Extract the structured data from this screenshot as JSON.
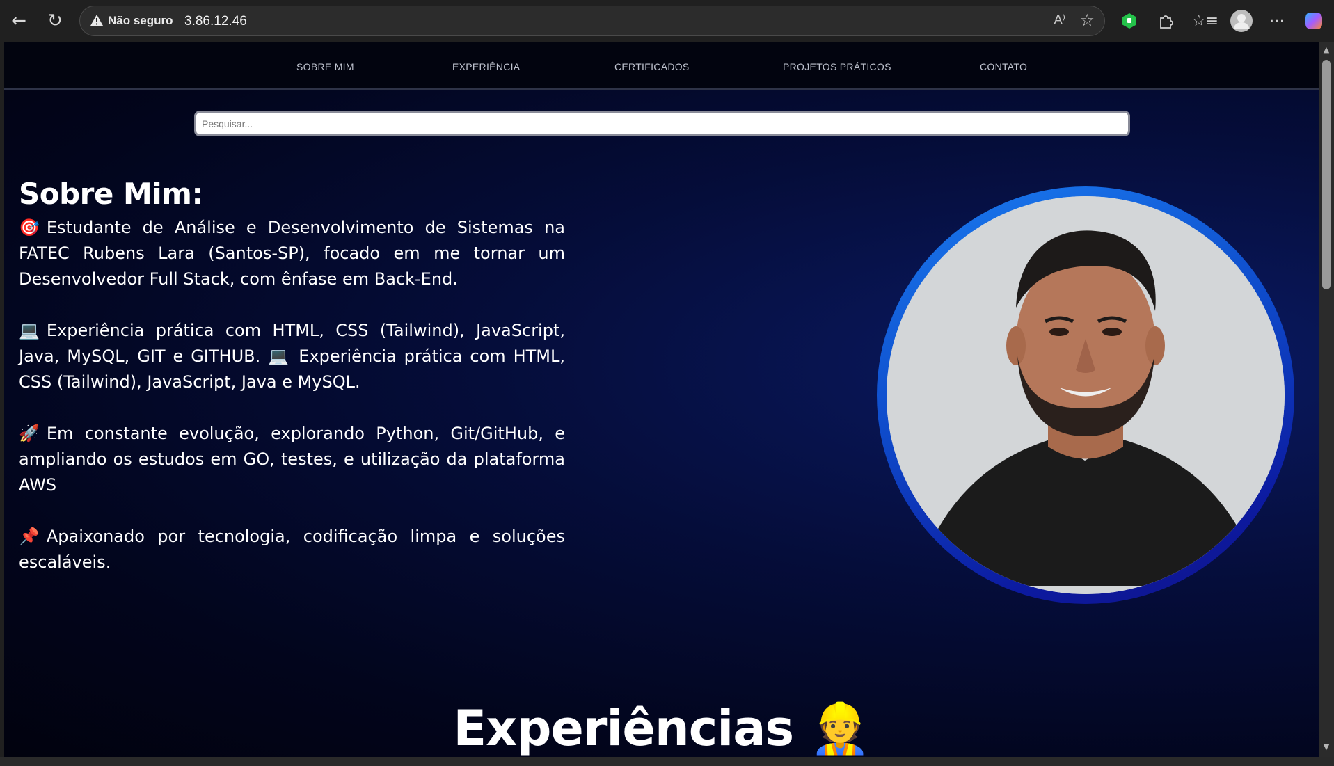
{
  "browser": {
    "security_label": "Não seguro",
    "url": "3.86.12.46",
    "read_aloud_label": "A⁾"
  },
  "site": {
    "nav": [
      "SOBRE MIM",
      "EXPERIÊNCIA",
      "CERTIFICADOS",
      "PROJETOS PRÁTICOS",
      "CONTATO"
    ],
    "search_placeholder": "Pesquisar...",
    "about_title": "Sobre Mim:",
    "about_paragraphs": [
      {
        "emoji": "🎯",
        "text": "Estudante de Análise e Desenvolvimento de Sistemas na FATEC Rubens Lara (Santos-SP), focado em me tornar um Desenvolvedor Full Stack, com ênfase em Back-End."
      },
      {
        "emoji": "💻",
        "text": "Experiência prática com HTML, CSS (Tailwind), JavaScript, Java, MySQL, GIT e GITHUB. 💻  Experiência prática com HTML, CSS (Tailwind), JavaScript, Java e MySQL."
      },
      {
        "emoji": "🚀",
        "text": "Em constante evolução, explorando Python, Git/GitHub, e ampliando os estudos em GO, testes, e utilização da plataforma AWS"
      },
      {
        "emoji": "📌",
        "text": "Apaixonado por tecnologia, codificação limpa e soluções escaláveis."
      }
    ],
    "experience_title": "Experiências 👷"
  }
}
